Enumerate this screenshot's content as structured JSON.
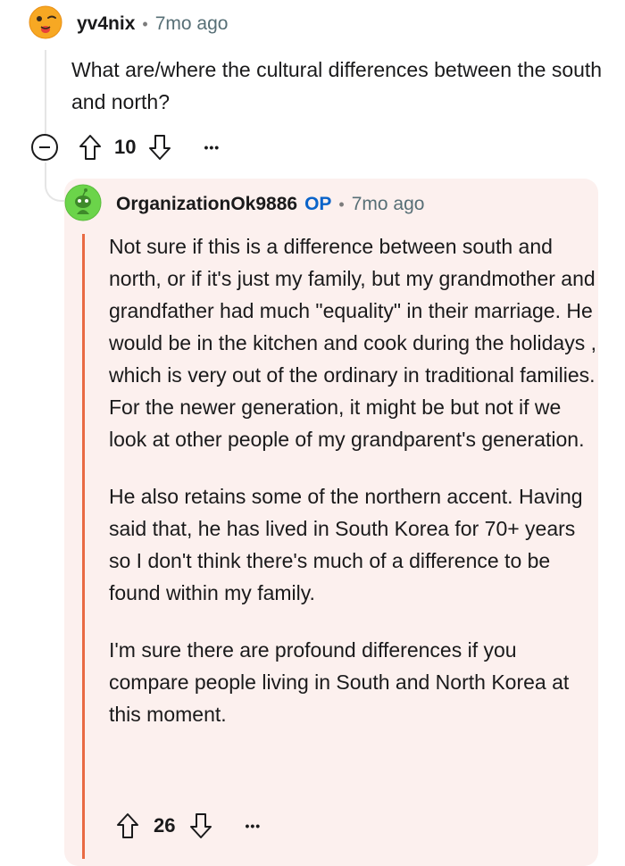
{
  "parent_comment": {
    "author": "yv4nix",
    "separator": "•",
    "time": "7mo ago",
    "body": "What are/where the cultural differences between the south and north?",
    "score": "10",
    "more_label": "•••"
  },
  "reply_comment": {
    "author": "OrganizationOk9886",
    "op_badge": "OP",
    "separator": "•",
    "time": "7mo ago",
    "paragraphs": [
      "Not sure if this is a difference between south and north, or if it's just my family, but my grandmother and grandfather had much \"equality\" in their marriage. He would be in the kitchen and cook during the holidays , which is very out of the ordinary in traditional families. For the newer generation, it might be but not if we look at other people of my grandparent's generation.",
      "He also retains some of the northern accent. Having said that, he has lived in South Korea for 70+ years so I don't think there's much of a difference to be found within my family.",
      "I'm sure there are profound differences if you compare people living in South and North Korea at this moment."
    ],
    "score": "26",
    "more_label": "•••"
  },
  "colors": {
    "reply_background": "#fcf0ee",
    "reply_accent_bar": "#e96a43",
    "op_badge": "#0a63c9",
    "thread_line": "#e5e5e5"
  },
  "icons": {
    "parent_avatar": "winking-face-avatar-icon",
    "reply_avatar": "green-snoo-avatar-icon",
    "collapse": "minus-circle-icon",
    "upvote": "arrow-up-icon",
    "downvote": "arrow-down-icon",
    "more": "ellipsis-icon"
  }
}
